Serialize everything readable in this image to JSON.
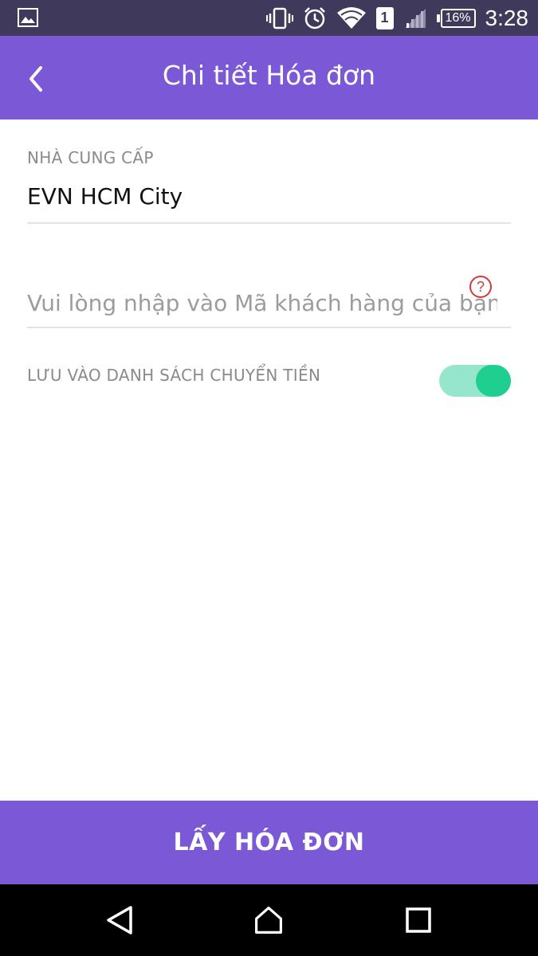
{
  "status_bar": {
    "time": "3:28",
    "battery_percent": "16%",
    "sim_slot": "1",
    "icons": [
      "image-icon",
      "vibrate-icon",
      "alarm-icon",
      "wifi-icon",
      "sim-icon",
      "signal-icon",
      "battery-icon"
    ]
  },
  "app_bar": {
    "title": "Chi tiết Hóa đơn"
  },
  "form": {
    "provider_label": "NHÀ CUNG CẤP",
    "provider_value": "EVN HCM City",
    "customer_code_placeholder": "Vui lòng nhập vào Mã khách hàng của bạn",
    "customer_code_value": "",
    "help_symbol": "?",
    "save_label": "LƯU VÀO DANH SÁCH CHUYỂN TIỀN",
    "save_enabled": true
  },
  "submit_label": "LẤY HÓA ĐƠN",
  "colors": {
    "status_bar": "#3f3a5c",
    "primary": "#7b59d6",
    "toggle_track": "#95e6cc",
    "toggle_thumb": "#1fcf8f",
    "help_accent": "#d33a3a"
  }
}
